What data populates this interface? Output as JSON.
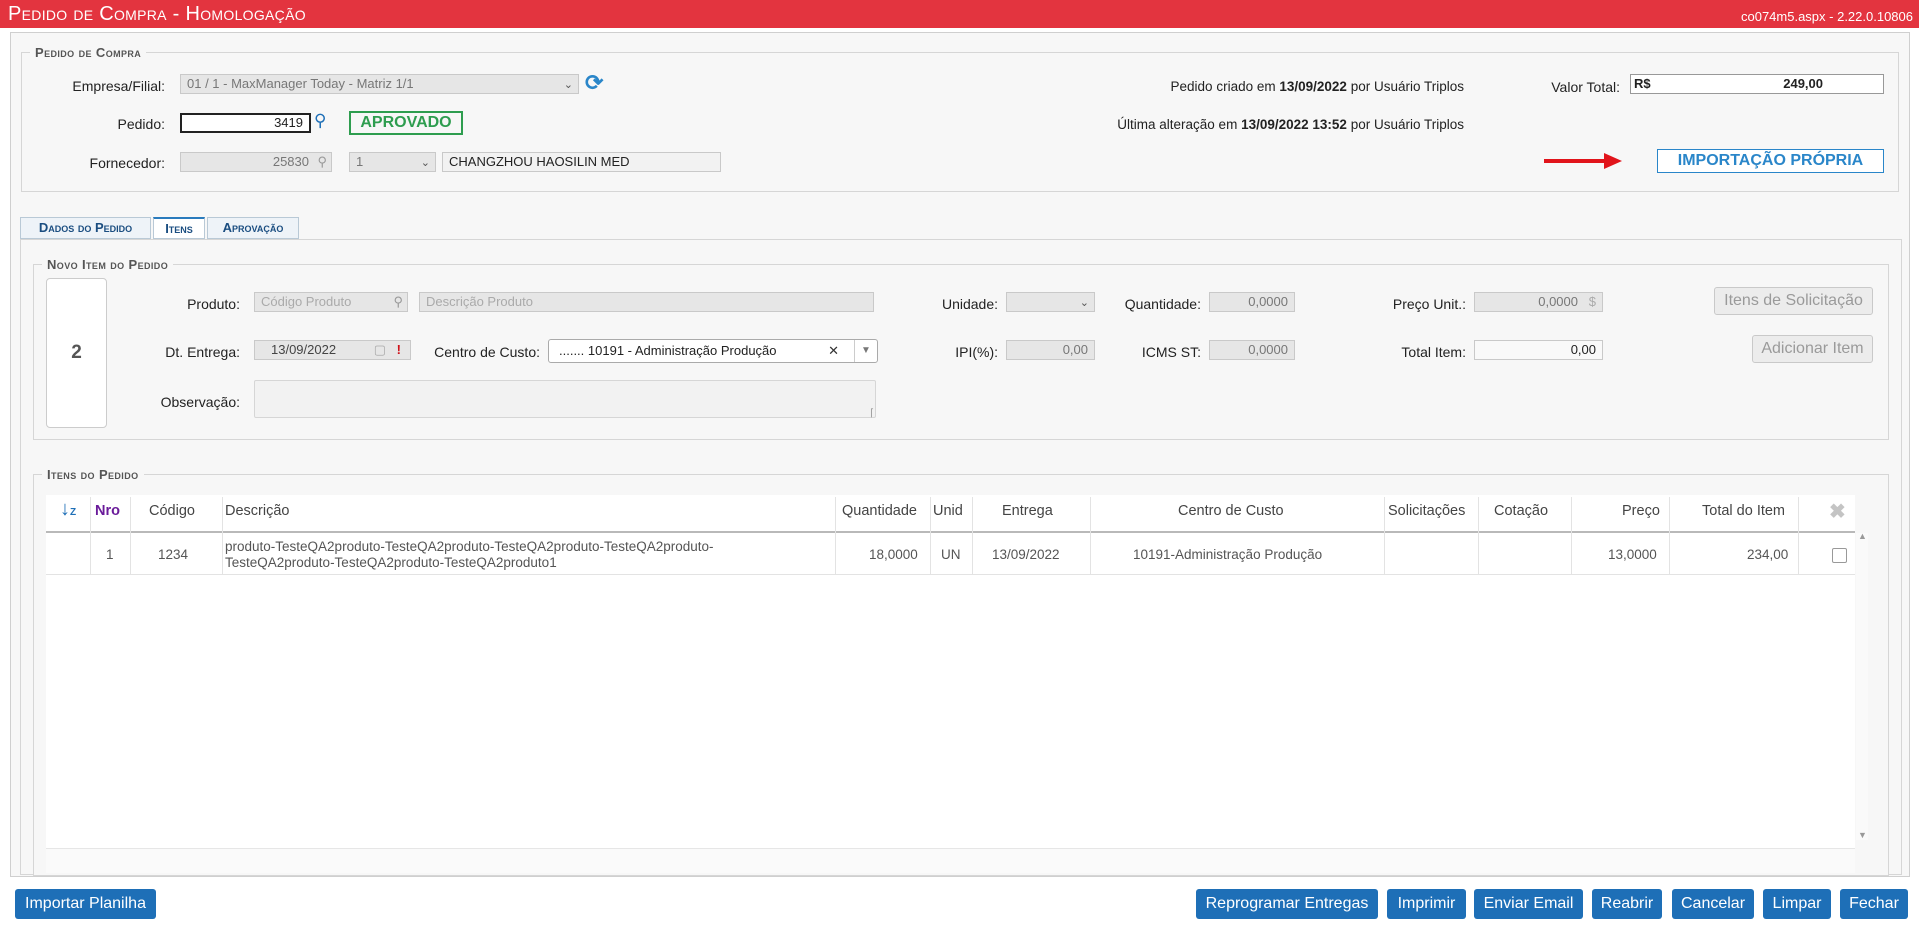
{
  "window": {
    "title": "Pedido de Compra  - Homologação",
    "version": "co074m5.aspx - 2.22.0.10806"
  },
  "pedido": {
    "legend": "Pedido de Compra",
    "empresa_label": "Empresa/Filial:",
    "empresa_value": "01 / 1 - MaxManager Today - Matriz 1/1",
    "pedido_label": "Pedido:",
    "pedido_value": "3419",
    "status": "APROVADO",
    "fornecedor_label": "Fornecedor:",
    "fornecedor_code": "25830",
    "fornecedor_seq": "1",
    "fornecedor_name": "CHANGZHOU HAOSILIN MED",
    "criado_prefix": "Pedido criado em",
    "criado_date": "13/09/2022",
    "criado_suffix": "por Usuário Triplos",
    "alteracao_prefix": "Última alteração em",
    "alteracao_date": "13/09/2022 13:52",
    "alteracao_suffix": "por Usuário Triplos",
    "valor_label": "Valor Total:",
    "valor_currency": "R$",
    "valor_value": "249,00",
    "importacao": "IMPORTAÇÃO PRÓPRIA"
  },
  "tabs": [
    {
      "label": "Dados do Pedido"
    },
    {
      "label": "Itens"
    },
    {
      "label": "Aprovação"
    }
  ],
  "novo_item": {
    "legend": "Novo Item do Pedido",
    "seq": "2",
    "produto_label": "Produto:",
    "produto_placeholder": "Código Produto",
    "descricao_placeholder": "Descrição Produto",
    "unidade_label": "Unidade:",
    "quantidade_label": "Quantidade:",
    "quantidade_value": "0,0000",
    "preco_label": "Preço Unit.:",
    "preco_value": "0,0000",
    "itens_solicitacao": "Itens de Solicitação",
    "entrega_label": "Dt. Entrega:",
    "entrega_value": "13/09/2022",
    "centro_label": "Centro de Custo:",
    "centro_value": "....... 10191 - Administração Produção",
    "ipi_label": "IPI(%):",
    "ipi_value": "0,00",
    "icms_label": "ICMS ST:",
    "icms_value": "0,0000",
    "total_label": "Total Item:",
    "total_value": "0,00",
    "adicionar": "Adicionar Item",
    "obs_label": "Observação:"
  },
  "itens": {
    "legend": "Itens do Pedido",
    "columns": [
      "Nro",
      "Código",
      "Descrição",
      "Quantidade",
      "Unid",
      "Entrega",
      "Centro de Custo",
      "Solicitações",
      "Cotação",
      "Preço",
      "Total do Item"
    ],
    "rows": [
      {
        "nro": "1",
        "codigo": "1234",
        "descricao_1": "produto-TesteQA2produto-TesteQA2produto-TesteQA2produto-TesteQA2produto-",
        "descricao_2": "TesteQA2produto-TesteQA2produto-TesteQA2produto1",
        "quantidade": "18,0000",
        "unid": "UN",
        "entrega": "13/09/2022",
        "centro": "10191-Administração Produção",
        "solicitacoes": "",
        "cotacao": "",
        "preco": "13,0000",
        "total": "234,00"
      }
    ]
  },
  "footer": {
    "importar": "Importar Planilha",
    "reprogramar": "Reprogramar Entregas",
    "imprimir": "Imprimir",
    "email": "Enviar Email",
    "reabrir": "Reabrir",
    "cancelar": "Cancelar",
    "limpar": "Limpar",
    "fechar": "Fechar"
  },
  "colors": {
    "title_bar": "#e3343f",
    "primary_button": "#1e6fb7",
    "status_green": "#2e9d4f",
    "import_blue": "#2a86c9",
    "arrow_red": "#e1141b"
  }
}
